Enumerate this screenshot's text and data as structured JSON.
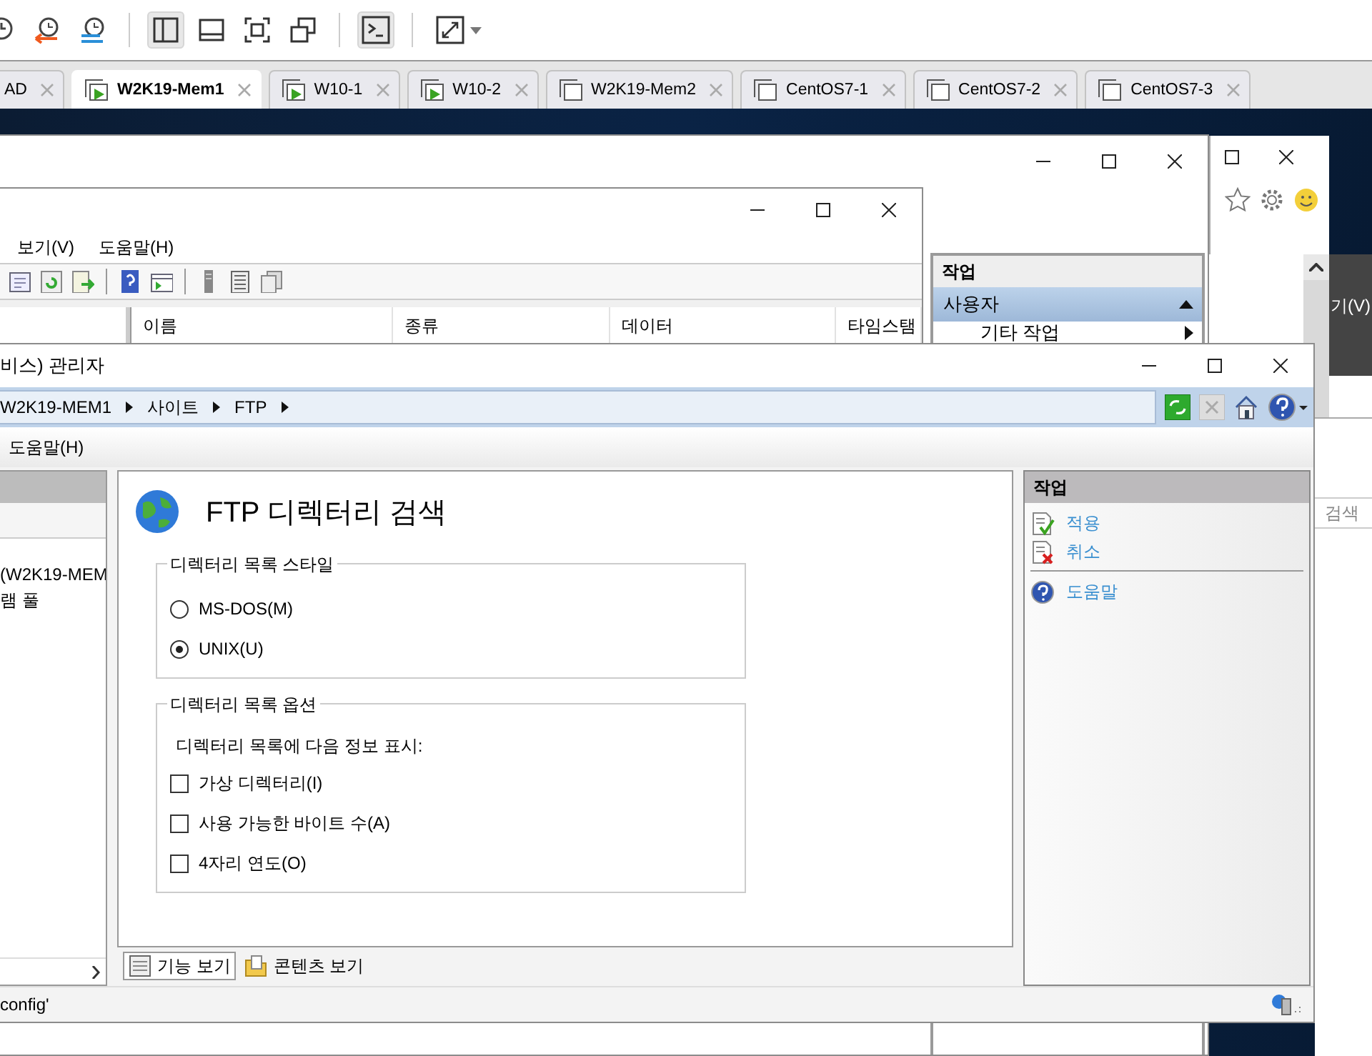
{
  "toolbar": [
    {
      "kind": "snapshot",
      "pressed": false
    },
    {
      "kind": "revert",
      "pressed": false
    },
    {
      "kind": "manage",
      "pressed": false
    },
    {
      "kind": "sep"
    },
    {
      "kind": "sidebar",
      "pressed": true
    },
    {
      "kind": "thumbnail",
      "pressed": false
    },
    {
      "kind": "fullscreen",
      "pressed": false
    },
    {
      "kind": "unity",
      "pressed": false
    },
    {
      "kind": "sep"
    },
    {
      "kind": "console",
      "pressed": true
    },
    {
      "kind": "sep"
    },
    {
      "kind": "stretch",
      "pressed": false
    }
  ],
  "vm_tabs": [
    {
      "label": "AD",
      "selected": false
    },
    {
      "label": "W2K19-Mem1",
      "selected": true,
      "running": true
    },
    {
      "label": "W10-1",
      "selected": false,
      "running": true
    },
    {
      "label": "W10-2",
      "selected": false,
      "running": true
    },
    {
      "label": "W2K19-Mem2",
      "selected": false,
      "running": false
    },
    {
      "label": "CentOS7-1",
      "selected": false,
      "running": false
    },
    {
      "label": "CentOS7-2",
      "selected": false,
      "running": false
    },
    {
      "label": "CentOS7-3",
      "selected": false,
      "running": false
    }
  ],
  "back_window": {
    "actions": {
      "title": "작업",
      "section": "사용자",
      "items": [
        "기타 작업"
      ]
    }
  },
  "browser_window": {
    "menu_item": "기(V)"
  },
  "registry_window": {
    "menus": [
      "보기(V)",
      "도움말(H)"
    ],
    "columns": [
      "이름",
      "종류",
      "데이터",
      "타임스탬"
    ]
  },
  "iis_window": {
    "title": "비스) 관리자",
    "breadcrumb": [
      "W2K19-MEM1",
      "사이트",
      "FTP"
    ],
    "menus": [
      "도움말(H)"
    ],
    "tree": [
      "(W2K19-MEM",
      "램 풀"
    ],
    "page_title": "FTP 디렉터리 검색",
    "style_group": {
      "title": "디렉터리 목록 스타일",
      "options": [
        {
          "label": "MS-DOS(M)",
          "selected": false
        },
        {
          "label": "UNIX(U)",
          "selected": true
        }
      ]
    },
    "options_group": {
      "title": "디렉터리 목록 옵션",
      "caption": "디렉터리 목록에 다음 정보 표시:",
      "options": [
        {
          "label": "가상 디렉터리(I)",
          "checked": false
        },
        {
          "label": "사용 가능한 바이트 수(A)",
          "checked": false
        },
        {
          "label": "4자리 연도(O)",
          "checked": false
        }
      ]
    },
    "view_tabs": [
      {
        "label": "기능 보기",
        "selected": true
      },
      {
        "label": "콘텐츠 보기",
        "selected": false
      }
    ],
    "actions": {
      "title": "작업",
      "groups": [
        [
          {
            "kind": "apply",
            "label": "적용"
          },
          {
            "kind": "cancel",
            "label": "취소"
          }
        ],
        [
          {
            "kind": "help",
            "label": "도움말"
          }
        ]
      ]
    },
    "status": "config'"
  },
  "side_window": {
    "search_placeholder": "검색"
  }
}
